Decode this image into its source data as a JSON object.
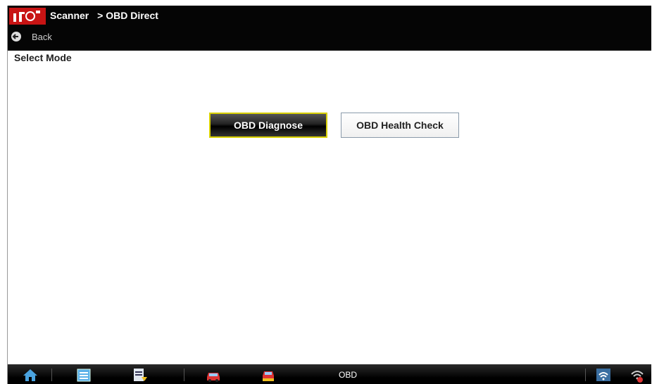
{
  "header": {
    "breadcrumb": [
      "Scanner",
      "> OBD Direct"
    ],
    "back_label": "Back"
  },
  "main": {
    "heading": "Select Mode",
    "buttons": [
      {
        "label": "OBD Diagnose",
        "selected": true
      },
      {
        "label": "OBD Health Check",
        "selected": false
      }
    ]
  },
  "bottombar": {
    "status_text": "OBD",
    "icons": [
      "home-icon",
      "vehicle-data-icon",
      "data-manager-icon",
      "scanner-car-icon",
      "vehicle-system-icon",
      "wifi-icon",
      "wifi-settings-icon"
    ]
  },
  "colors": {
    "header_bg": "#050505",
    "logo_red": "#cc1111",
    "selected_border": "#d8d000"
  }
}
